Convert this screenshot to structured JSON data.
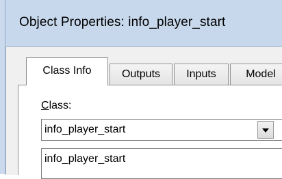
{
  "window": {
    "title": "Object Properties: info_player_start"
  },
  "tabs": [
    {
      "label": "Class Info",
      "active": true
    },
    {
      "label": "Outputs",
      "active": false
    },
    {
      "label": "Inputs",
      "active": false
    },
    {
      "label": "Model",
      "active": false
    }
  ],
  "class_field": {
    "label_accel": "C",
    "label_rest": "lass:",
    "selected_value": "info_player_start",
    "list_items": [
      "info_player_start"
    ]
  },
  "icons": {
    "dropdown": "chevron-down-icon"
  },
  "colors": {
    "titlebar": "#c7d8ec",
    "client_bg": "#f0f0f0",
    "border": "#8e8f8f"
  }
}
